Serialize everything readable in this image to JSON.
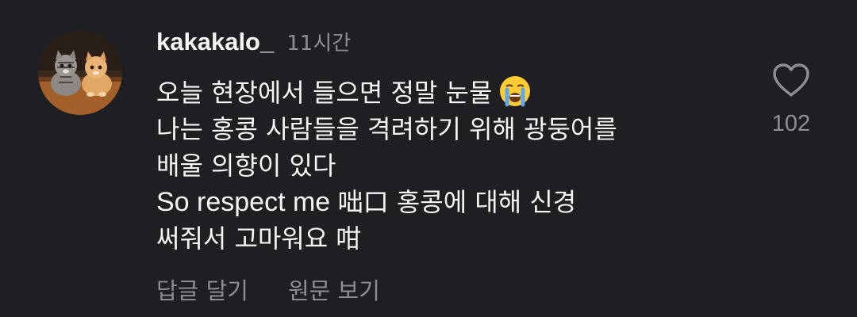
{
  "comment": {
    "username": "kakakalo_",
    "time": "11시간",
    "lines": {
      "l1": "오늘 현장에서 들으면 정말 눈물",
      "l2": "나는 홍콩 사람들을 격려하기 위해 광둥어를",
      "l3": "배울 의향이 있다",
      "l4_latin": "So respect me ",
      "l4_rest": "咄口 홍콩에 대해 신경",
      "l5": "써줘서 고마워요 咁"
    },
    "emoji": "loudly-crying-face",
    "actions": {
      "reply": "답글 달기",
      "view_original": "원문 보기"
    },
    "likes": {
      "count": "102",
      "icon": "heart-outline-icon"
    },
    "colors": {
      "background": "#1e1e23",
      "text": "#f5f5f5",
      "secondary": "#8e8e93"
    }
  }
}
